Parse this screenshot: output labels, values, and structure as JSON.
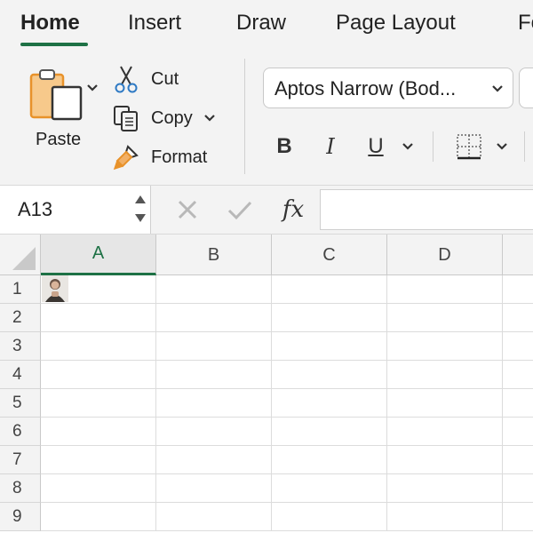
{
  "ribbon": {
    "tabs": [
      {
        "label": "Home",
        "active": true
      },
      {
        "label": "Insert",
        "active": false
      },
      {
        "label": "Draw",
        "active": false
      },
      {
        "label": "Page Layout",
        "active": false
      },
      {
        "label": "Fo",
        "active": false
      }
    ],
    "clipboard": {
      "paste_label": "Paste",
      "cut_label": "Cut",
      "copy_label": "Copy",
      "format_label": "Format"
    },
    "font": {
      "name": "Aptos Narrow (Bod...",
      "bold_label": "B",
      "italic_label": "I",
      "underline_label": "U"
    }
  },
  "formula_bar": {
    "name_box": "A13",
    "fx_label": "fx",
    "value": ""
  },
  "grid": {
    "columns": [
      {
        "label": "A",
        "active": true
      },
      {
        "label": "B",
        "active": false
      },
      {
        "label": "C",
        "active": false
      },
      {
        "label": "D",
        "active": false
      }
    ],
    "rows": [
      "1",
      "2",
      "3",
      "4",
      "5",
      "6",
      "7",
      "8",
      "9"
    ]
  },
  "colors": {
    "accent": "#1e7145",
    "ribbon_bg": "#f3f3f3",
    "paste_orange": "#e8922a"
  }
}
